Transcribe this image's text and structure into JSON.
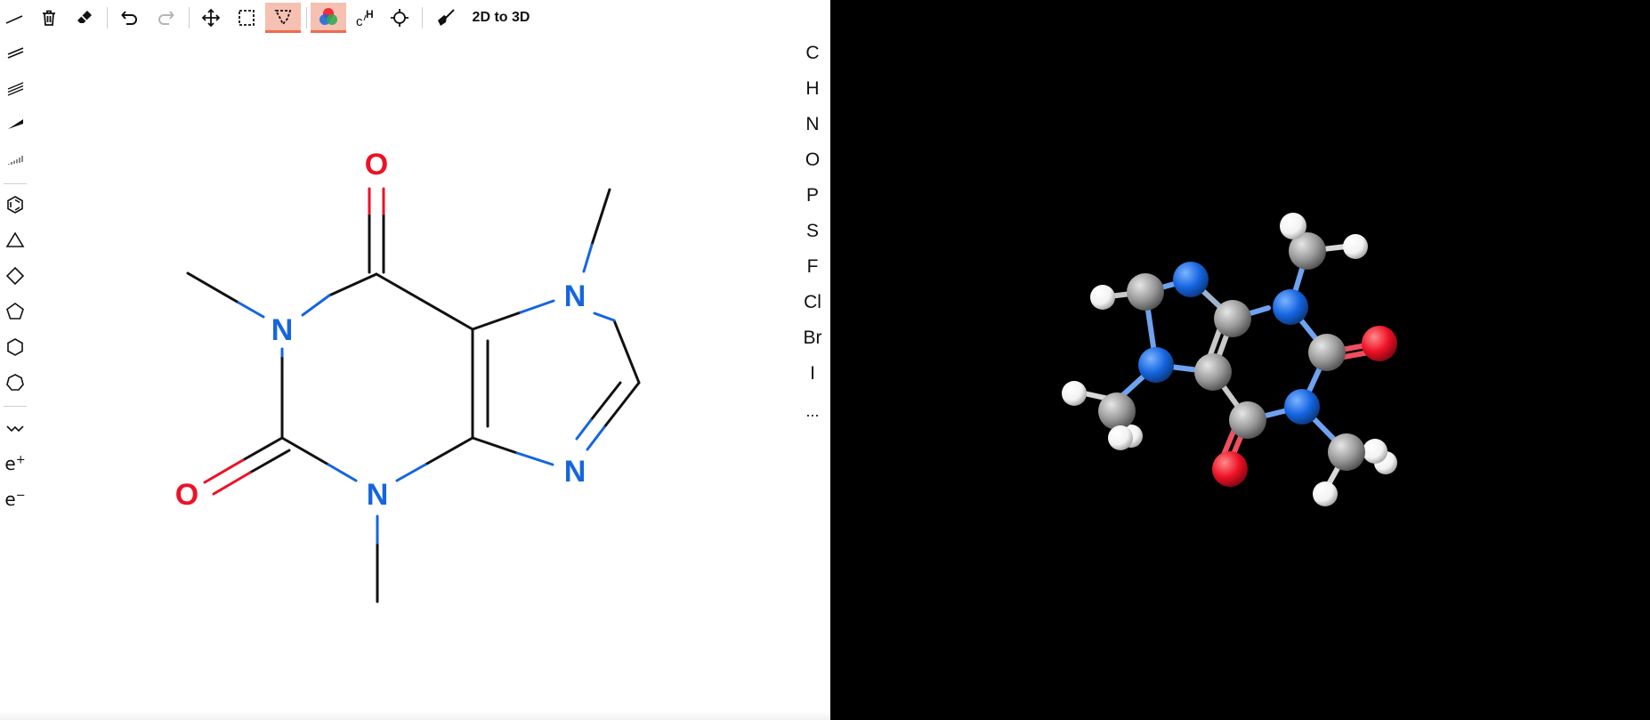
{
  "toolbar": {
    "convert_label": "2D to 3D",
    "tools": [
      {
        "name": "single-bond-tool",
        "icon": "single-bond-icon"
      },
      {
        "name": "delete-tool",
        "icon": "trash-icon"
      },
      {
        "name": "eraser-tool",
        "icon": "eraser-icon"
      },
      {
        "name": "undo-tool",
        "icon": "undo-icon"
      },
      {
        "name": "redo-tool",
        "icon": "redo-icon",
        "disabled": true
      },
      {
        "name": "move-tool",
        "icon": "move-arrows-icon"
      },
      {
        "name": "rect-select-tool",
        "icon": "rect-select-icon"
      },
      {
        "name": "lasso-select-tool",
        "icon": "lasso-icon",
        "active": true
      },
      {
        "name": "color-mode-toggle",
        "icon": "color-circles-icon",
        "active": true
      },
      {
        "name": "hydrogen-toggle",
        "icon": "ch-label-icon"
      },
      {
        "name": "center-tool",
        "icon": "crosshair-icon"
      },
      {
        "name": "clean-tool",
        "icon": "broom-icon"
      }
    ]
  },
  "left_tools": {
    "bonds": [
      "double-bond-icon",
      "triple-bond-icon",
      "wedge-bond-icon",
      "hash-bond-icon"
    ],
    "rings": [
      "benzene-icon",
      "triangle-icon",
      "square-icon",
      "pentagon-icon",
      "hexagon-icon",
      "heptagon-icon"
    ],
    "chain": "chain-icon",
    "charge_plus": "e",
    "charge_plus_sign": "+",
    "charge_minus": "e",
    "charge_minus_sign": "−"
  },
  "elements": [
    "C",
    "H",
    "N",
    "O",
    "P",
    "S",
    "F",
    "Cl",
    "Br",
    "I",
    "..."
  ],
  "colors": {
    "nitrogen": "#1565e0",
    "oxygen": "#ee1126",
    "carbon_2d": "#111111",
    "carbon_3d": "#9a9a9a",
    "hydrogen_3d": "#f2f2f2",
    "toolbar_active_bg": "#f6c0b3",
    "toolbar_active_border": "#ee6b4d",
    "viewer_bg": "#000000"
  },
  "molecule_2d": {
    "labels": [
      "O",
      "N",
      "O",
      "N",
      "N",
      "N"
    ]
  }
}
